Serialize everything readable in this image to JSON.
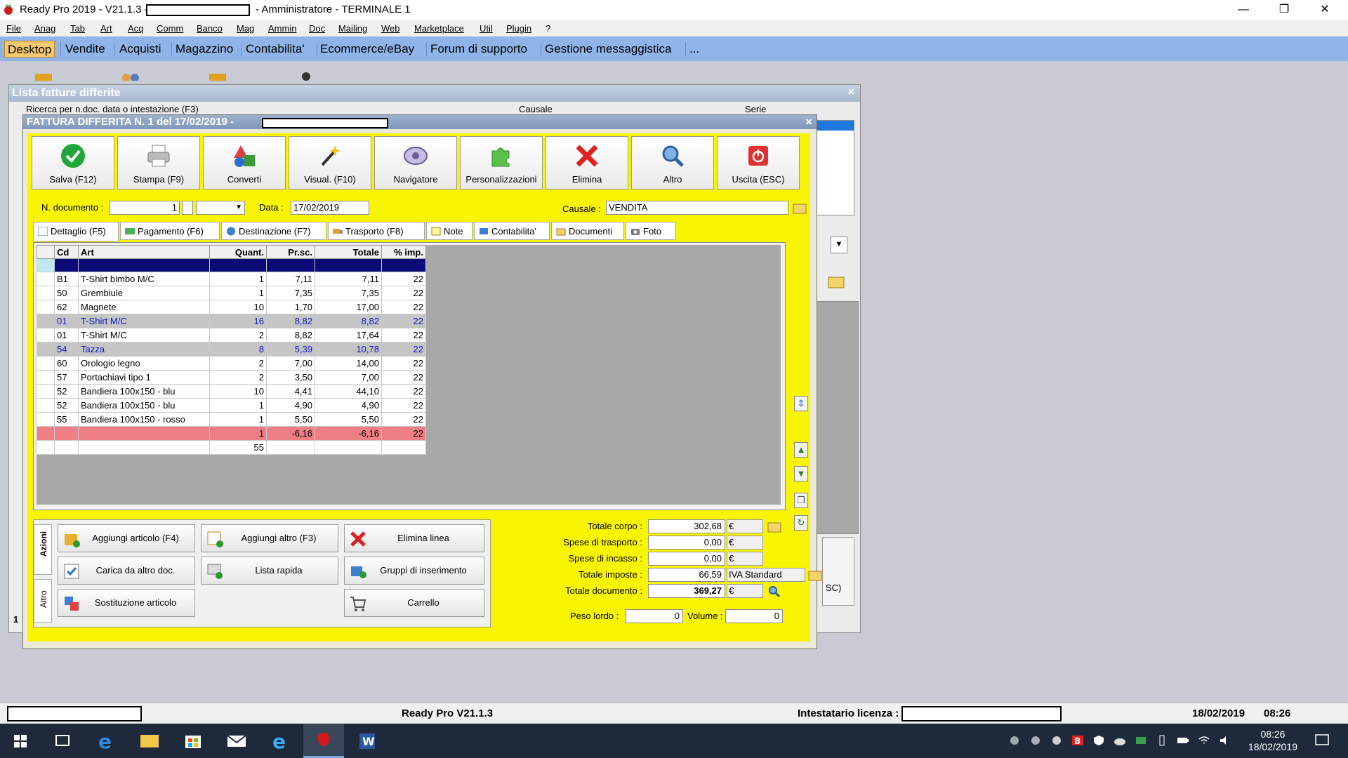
{
  "window": {
    "title_prefix": "Ready Pro 2019 - V21.1.3 -",
    "title_suffix": "- Amministratore - TERMINALE 1",
    "minimize": "—",
    "restore": "❐",
    "close": "✕"
  },
  "menu": [
    "File",
    "Anag",
    "Tab",
    "Art",
    "Acq",
    "Comm",
    "Banco",
    "Mag",
    "Ammin",
    "Doc",
    "Mailing",
    "Web",
    "Marketplace",
    "Util",
    "Plugin",
    "?"
  ],
  "tabs": [
    "Desktop",
    "Vendite",
    "Acquisti",
    "Magazzino",
    "Contabilita'",
    "Ecommerce/eBay",
    "Forum di supporto",
    "Gestione messaggistica",
    "..."
  ],
  "bg_window": {
    "title": "Lista fatture differite",
    "search_label": "Ricerca per n.doc. data o intestazione (F3)",
    "causale_label": "Causale",
    "serie_label": "Serie",
    "side_text": "SC)",
    "row_num": "1"
  },
  "dialog": {
    "title": "FATTURA DIFFERITA N. 1 del 17/02/2019 -",
    "close": "×",
    "toolbar": [
      "Salva (F12)",
      "Stampa (F9)",
      "Converti",
      "Visual. (F10)",
      "Navigatore",
      "Personalizzazioni",
      "Elimina",
      "Altro",
      "Uscita (ESC)"
    ],
    "ndoc_label": "N. documento :",
    "ndoc_value": "1",
    "data_label": "Data :",
    "data_value": "17/02/2019",
    "causale_label": "Causale :",
    "causale_value": "VENDITA",
    "subtabs": [
      "Dettaglio (F5)",
      "Pagamento (F6)",
      "Destinazione (F7)",
      "Trasporto (F8)",
      "Note",
      "Contabilita'",
      "Documenti",
      "Foto"
    ]
  },
  "grid": {
    "headers": [
      "Cd",
      "Art",
      "Quant.",
      "Pr.sc.",
      "Totale",
      "% imp."
    ],
    "rows": [
      {
        "cd": "B1",
        "art": "T-Shirt bimbo M/C",
        "q": "1",
        "p": "7,11",
        "t": "7,11",
        "i": "22",
        "style": ""
      },
      {
        "cd": "50",
        "art": "Grembiule",
        "q": "1",
        "p": "7,35",
        "t": "7,35",
        "i": "22",
        "style": ""
      },
      {
        "cd": "62",
        "art": "Magnete",
        "q": "10",
        "p": "1,70",
        "t": "17,00",
        "i": "22",
        "style": ""
      },
      {
        "cd": "01",
        "art": "T-Shirt M/C",
        "q": "16",
        "p": "8,82",
        "t": "8,82",
        "i": "22",
        "style": "gray"
      },
      {
        "cd": "01",
        "art": "T-Shirt M/C",
        "q": "2",
        "p": "8,82",
        "t": "17,64",
        "i": "22",
        "style": ""
      },
      {
        "cd": "54",
        "art": "Tazza",
        "q": "8",
        "p": "5,39",
        "t": "10,78",
        "i": "22",
        "style": "gray"
      },
      {
        "cd": "60",
        "art": "Orologio legno",
        "q": "2",
        "p": "7,00",
        "t": "14,00",
        "i": "22",
        "style": ""
      },
      {
        "cd": "57",
        "art": "Portachiavi tipo 1",
        "q": "2",
        "p": "3,50",
        "t": "7,00",
        "i": "22",
        "style": ""
      },
      {
        "cd": "52",
        "art": "Bandiera 100x150 - blu",
        "q": "10",
        "p": "4,41",
        "t": "44,10",
        "i": "22",
        "style": ""
      },
      {
        "cd": "52",
        "art": "Bandiera 100x150 - blu",
        "q": "1",
        "p": "4,90",
        "t": "4,90",
        "i": "22",
        "style": ""
      },
      {
        "cd": "55",
        "art": "Bandiera 100x150 - rosso",
        "q": "1",
        "p": "5,50",
        "t": "5,50",
        "i": "22",
        "style": ""
      },
      {
        "cd": "",
        "art": "",
        "q": "1",
        "p": "-6,16",
        "t": "-6,16",
        "i": "22",
        "style": "red"
      }
    ],
    "total_qty": "55"
  },
  "actions": {
    "tab_azioni": "Azioni",
    "tab_altro": "Altro",
    "buttons": [
      "Aggiungi articolo (F4)",
      "Aggiungi altro (F3)",
      "Elimina linea",
      "Carica da altro doc.",
      "Lista rapida",
      "Gruppi di inserimento",
      "Sostituzione articolo",
      "Carrello"
    ]
  },
  "totals": {
    "corpo_label": "Totale corpo :",
    "corpo_value": "302,68",
    "trasporto_label": "Spese di trasporto :",
    "trasporto_value": "0,00",
    "incasso_label": "Spese di incasso :",
    "incasso_value": "0,00",
    "imposte_label": "Totale imposte :",
    "imposte_value": "66,59",
    "iva_label": "IVA Standard",
    "documento_label": "Totale documento :",
    "documento_value": "369,27",
    "currency": "€",
    "peso_label": "Peso lordo :",
    "peso_value": "0",
    "volume_label": "Volume :",
    "volume_value": "0"
  },
  "statusbar": {
    "version": "Ready Pro V21.1.3",
    "licenza_label": "Intestatario licenza :",
    "date": "18/02/2019",
    "time": "08:26"
  },
  "taskbar": {
    "clock_time": "08:26",
    "clock_date": "18/02/2019"
  },
  "colors": {
    "yellow_panel": "#f9f500",
    "tabbar": "#8fb5e8",
    "navy_row": "#0b0b78",
    "red_row": "#f07f85"
  }
}
